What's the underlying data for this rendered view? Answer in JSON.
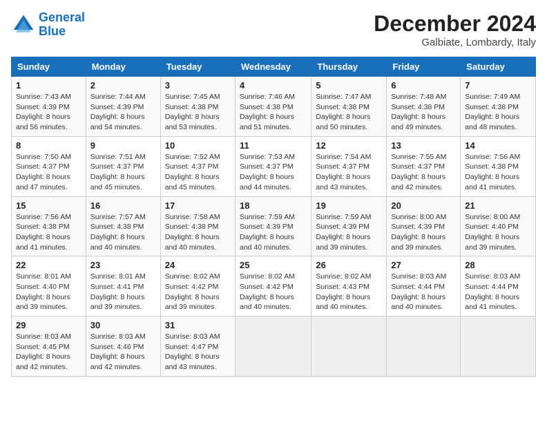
{
  "header": {
    "logo_line1": "General",
    "logo_line2": "Blue",
    "month": "December 2024",
    "location": "Galbiate, Lombardy, Italy"
  },
  "days_of_week": [
    "Sunday",
    "Monday",
    "Tuesday",
    "Wednesday",
    "Thursday",
    "Friday",
    "Saturday"
  ],
  "weeks": [
    [
      {
        "day": "1",
        "info": "Sunrise: 7:43 AM\nSunset: 4:39 PM\nDaylight: 8 hours and 56 minutes."
      },
      {
        "day": "2",
        "info": "Sunrise: 7:44 AM\nSunset: 4:39 PM\nDaylight: 8 hours and 54 minutes."
      },
      {
        "day": "3",
        "info": "Sunrise: 7:45 AM\nSunset: 4:38 PM\nDaylight: 8 hours and 53 minutes."
      },
      {
        "day": "4",
        "info": "Sunrise: 7:46 AM\nSunset: 4:38 PM\nDaylight: 8 hours and 51 minutes."
      },
      {
        "day": "5",
        "info": "Sunrise: 7:47 AM\nSunset: 4:38 PM\nDaylight: 8 hours and 50 minutes."
      },
      {
        "day": "6",
        "info": "Sunrise: 7:48 AM\nSunset: 4:38 PM\nDaylight: 8 hours and 49 minutes."
      },
      {
        "day": "7",
        "info": "Sunrise: 7:49 AM\nSunset: 4:38 PM\nDaylight: 8 hours and 48 minutes."
      }
    ],
    [
      {
        "day": "8",
        "info": "Sunrise: 7:50 AM\nSunset: 4:37 PM\nDaylight: 8 hours and 47 minutes."
      },
      {
        "day": "9",
        "info": "Sunrise: 7:51 AM\nSunset: 4:37 PM\nDaylight: 8 hours and 45 minutes."
      },
      {
        "day": "10",
        "info": "Sunrise: 7:52 AM\nSunset: 4:37 PM\nDaylight: 8 hours and 45 minutes."
      },
      {
        "day": "11",
        "info": "Sunrise: 7:53 AM\nSunset: 4:37 PM\nDaylight: 8 hours and 44 minutes."
      },
      {
        "day": "12",
        "info": "Sunrise: 7:54 AM\nSunset: 4:37 PM\nDaylight: 8 hours and 43 minutes."
      },
      {
        "day": "13",
        "info": "Sunrise: 7:55 AM\nSunset: 4:37 PM\nDaylight: 8 hours and 42 minutes."
      },
      {
        "day": "14",
        "info": "Sunrise: 7:56 AM\nSunset: 4:38 PM\nDaylight: 8 hours and 41 minutes."
      }
    ],
    [
      {
        "day": "15",
        "info": "Sunrise: 7:56 AM\nSunset: 4:38 PM\nDaylight: 8 hours and 41 minutes."
      },
      {
        "day": "16",
        "info": "Sunrise: 7:57 AM\nSunset: 4:38 PM\nDaylight: 8 hours and 40 minutes."
      },
      {
        "day": "17",
        "info": "Sunrise: 7:58 AM\nSunset: 4:38 PM\nDaylight: 8 hours and 40 minutes."
      },
      {
        "day": "18",
        "info": "Sunrise: 7:59 AM\nSunset: 4:39 PM\nDaylight: 8 hours and 40 minutes."
      },
      {
        "day": "19",
        "info": "Sunrise: 7:59 AM\nSunset: 4:39 PM\nDaylight: 8 hours and 39 minutes."
      },
      {
        "day": "20",
        "info": "Sunrise: 8:00 AM\nSunset: 4:39 PM\nDaylight: 8 hours and 39 minutes."
      },
      {
        "day": "21",
        "info": "Sunrise: 8:00 AM\nSunset: 4:40 PM\nDaylight: 8 hours and 39 minutes."
      }
    ],
    [
      {
        "day": "22",
        "info": "Sunrise: 8:01 AM\nSunset: 4:40 PM\nDaylight: 8 hours and 39 minutes."
      },
      {
        "day": "23",
        "info": "Sunrise: 8:01 AM\nSunset: 4:41 PM\nDaylight: 8 hours and 39 minutes."
      },
      {
        "day": "24",
        "info": "Sunrise: 8:02 AM\nSunset: 4:42 PM\nDaylight: 8 hours and 39 minutes."
      },
      {
        "day": "25",
        "info": "Sunrise: 8:02 AM\nSunset: 4:42 PM\nDaylight: 8 hours and 40 minutes."
      },
      {
        "day": "26",
        "info": "Sunrise: 8:02 AM\nSunset: 4:43 PM\nDaylight: 8 hours and 40 minutes."
      },
      {
        "day": "27",
        "info": "Sunrise: 8:03 AM\nSunset: 4:44 PM\nDaylight: 8 hours and 40 minutes."
      },
      {
        "day": "28",
        "info": "Sunrise: 8:03 AM\nSunset: 4:44 PM\nDaylight: 8 hours and 41 minutes."
      }
    ],
    [
      {
        "day": "29",
        "info": "Sunrise: 8:03 AM\nSunset: 4:45 PM\nDaylight: 8 hours and 42 minutes."
      },
      {
        "day": "30",
        "info": "Sunrise: 8:03 AM\nSunset: 4:46 PM\nDaylight: 8 hours and 42 minutes."
      },
      {
        "day": "31",
        "info": "Sunrise: 8:03 AM\nSunset: 4:47 PM\nDaylight: 8 hours and 43 minutes."
      },
      {
        "day": "",
        "info": ""
      },
      {
        "day": "",
        "info": ""
      },
      {
        "day": "",
        "info": ""
      },
      {
        "day": "",
        "info": ""
      }
    ]
  ]
}
